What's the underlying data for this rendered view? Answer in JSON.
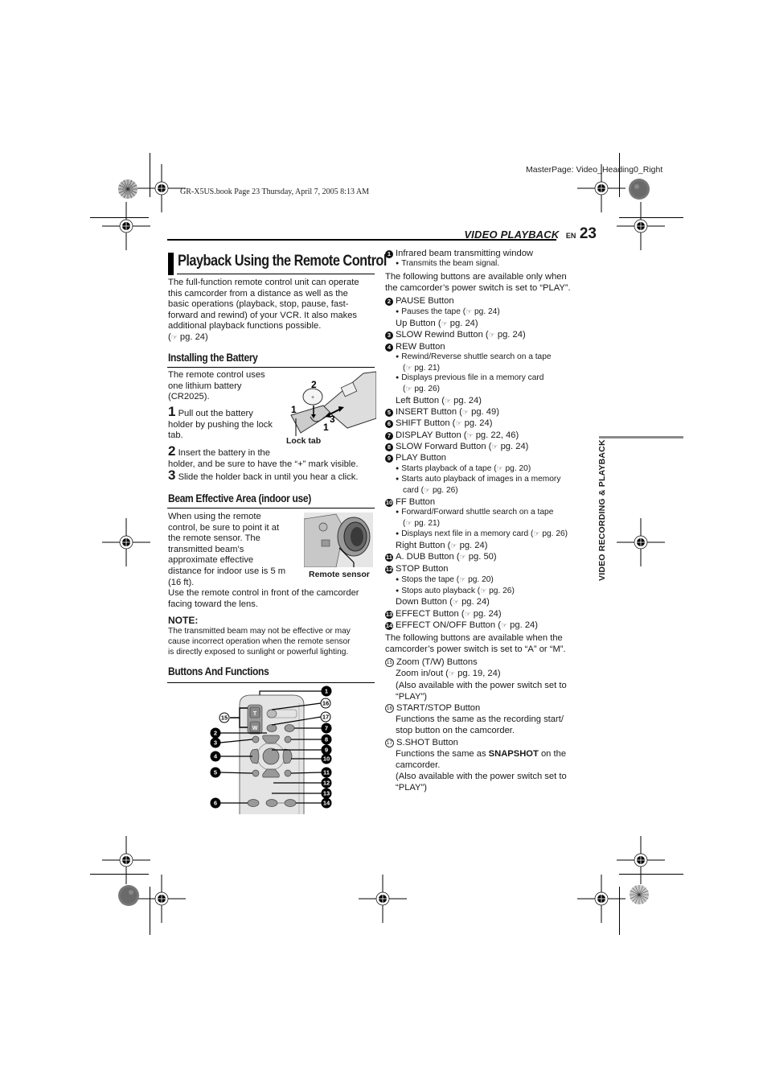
{
  "print_marks": {
    "book_info": "GR-X5US.book  Page 23  Thursday, April 7, 2005  8:13 AM",
    "master_page": "MasterPage: Video_Heading0_Right"
  },
  "header": {
    "section": "VIDEO PLAYBACK",
    "lang": "EN",
    "page_number": "23"
  },
  "sidebar": {
    "label": "VIDEO RECORDING & PLAYBACK",
    "bar_color": "#8a8a8a"
  },
  "main": {
    "title": "Playback Using the Remote Control",
    "intro": [
      "The full-function remote control unit can operate",
      "this camcorder from a distance as well as the",
      "basic operations (playback, stop, pause, fast-",
      "forward and rewind) of your VCR. It also makes",
      "additional playback functions possible."
    ],
    "intro_ref": "pg. 24",
    "battery": {
      "heading": "Installing the Battery",
      "text": [
        "The remote control uses",
        "one lithium battery",
        "(CR2025)."
      ],
      "steps": [
        {
          "num": "1",
          "lines": [
            "Pull out the battery",
            "holder by pushing the lock",
            "tab."
          ]
        },
        {
          "num": "2",
          "lines": [
            "Insert the battery in the",
            "holder, and be sure to have the “+” mark visible."
          ]
        },
        {
          "num": "3",
          "lines": [
            "Slide the holder back in until you hear a click."
          ]
        }
      ],
      "figure": {
        "callouts": [
          "2",
          "1",
          "3",
          "1"
        ],
        "caption": "Lock tab",
        "coin_mark": "+"
      }
    },
    "beam": {
      "heading": "Beam Effective Area (indoor use)",
      "text": [
        "When using the remote",
        "control, be sure to point it at",
        "the remote sensor. The",
        "transmitted beam’s",
        "approximate effective",
        "distance for indoor use is 5 m",
        "(16 ft)."
      ],
      "text2": [
        "Use the remote control in front of the camcorder",
        "facing toward the lens."
      ],
      "figure_caption": "Remote sensor"
    },
    "note": {
      "heading": "NOTE:",
      "lines": [
        "The transmitted beam may not be effective or may",
        "cause incorrect operation when the remote sensor",
        "is directly exposed to sunlight or powerful lighting."
      ]
    },
    "buttons": {
      "heading": "Buttons And Functions",
      "diagram": {
        "zoom_t": "T",
        "zoom_w": "W",
        "callouts_left": [
          "15",
          "2",
          "3",
          "4",
          "5",
          "6"
        ],
        "callouts_right": [
          "1",
          "16",
          "17",
          "7",
          "8",
          "9",
          "10",
          "11",
          "12",
          "13",
          "14"
        ]
      }
    }
  },
  "functions": {
    "intro_play": [
      "The following buttons are available only when",
      "the camcorder’s power switch is set to “PLAY”."
    ],
    "intro_am": [
      "The following buttons are available when the",
      "camcorder’s power switch is set to “A” or “M”."
    ],
    "items": [
      {
        "num": "1",
        "style": "filled",
        "label": "Infrared beam transmitting window",
        "subs": [
          {
            "text": "Transmits the beam signal."
          }
        ],
        "extra": []
      },
      {
        "num": "2",
        "style": "filled",
        "label": "PAUSE Button",
        "subs": [
          {
            "text": "Pauses the tape (",
            "ref": "pg. 24)"
          }
        ],
        "extra": [
          {
            "text": "Up Button (",
            "ref": "pg. 24)"
          }
        ]
      },
      {
        "num": "3",
        "style": "filled",
        "label": "SLOW Rewind Button (",
        "ref": "pg. 24)",
        "subs": [],
        "extra": []
      },
      {
        "num": "4",
        "style": "filled",
        "label": "REW Button",
        "subs": [
          {
            "text": "Rewind/Reverse shuttle search on a tape",
            "ref2": "pg. 21)"
          },
          {
            "text": "Displays previous file in a memory card",
            "ref2": "pg. 26)"
          }
        ],
        "extra": [
          {
            "text": "Left Button (",
            "ref": "pg. 24)"
          }
        ]
      },
      {
        "num": "5",
        "style": "filled",
        "label": "INSERT Button (",
        "ref": "pg. 49)",
        "subs": [],
        "extra": []
      },
      {
        "num": "6",
        "style": "filled",
        "label": "SHIFT Button (",
        "ref": "pg. 24)",
        "subs": [],
        "extra": []
      },
      {
        "num": "7",
        "style": "filled",
        "label": "DISPLAY Button (",
        "ref": "pg. 22, 46)",
        "subs": [],
        "extra": []
      },
      {
        "num": "8",
        "style": "filled",
        "label": "SLOW Forward Button (",
        "ref": "pg. 24)",
        "subs": [],
        "extra": []
      },
      {
        "num": "9",
        "style": "filled",
        "label": "PLAY Button",
        "subs": [
          {
            "text": "Starts playback of a tape (",
            "ref": "pg. 20)"
          },
          {
            "text": "Starts auto playback of images in a memory",
            "cont": "card (",
            "ref2": "pg. 26)"
          }
        ],
        "extra": []
      },
      {
        "num": "10",
        "style": "filled",
        "label": "FF Button",
        "subs": [
          {
            "text": "Forward/Forward shuttle search on a tape",
            "ref2": "pg. 21)"
          },
          {
            "text": "Displays next file in a memory card (",
            "ref": "pg. 26)"
          }
        ],
        "extra": [
          {
            "text": "Right Button (",
            "ref": "pg. 24)"
          }
        ]
      },
      {
        "num": "11",
        "style": "filled",
        "label": "A. DUB Button (",
        "ref": "pg. 50)",
        "subs": [],
        "extra": []
      },
      {
        "num": "12",
        "style": "filled",
        "label": "STOP Button",
        "subs": [
          {
            "text": "Stops the tape (",
            "ref": "pg. 20)"
          },
          {
            "text": "Stops auto playback (",
            "ref": "pg. 26)"
          }
        ],
        "extra": [
          {
            "text": "Down Button (",
            "ref": "pg. 24)"
          }
        ]
      },
      {
        "num": "13",
        "style": "filled",
        "label": "EFFECT Button (",
        "ref": "pg. 24)",
        "subs": [],
        "extra": []
      },
      {
        "num": "14",
        "style": "filled",
        "label": "EFFECT ON/OFF Button (",
        "ref": "pg. 24)",
        "subs": [],
        "extra": []
      },
      {
        "num": "15",
        "style": "outline",
        "label": "Zoom (T/W) Buttons",
        "subs": [],
        "extra": [
          {
            "text": "Zoom in/out (",
            "ref": "pg. 19, 24)"
          },
          {
            "text": "(Also available with the power switch set to"
          },
          {
            "text": "“PLAY”)"
          }
        ]
      },
      {
        "num": "16",
        "style": "outline",
        "label": "START/STOP Button",
        "subs": [],
        "extra": [
          {
            "text": "Functions the same as the recording start/"
          },
          {
            "text": "stop button on the camcorder."
          }
        ]
      },
      {
        "num": "17",
        "style": "outline",
        "label": "S.SHOT Button",
        "subs": [],
        "extra": [
          {
            "text": "Functions the same as ",
            "bold": "SNAPSHOT",
            "after": " on the"
          },
          {
            "text": "camcorder."
          },
          {
            "text": "(Also available with the power switch set to"
          },
          {
            "text": "“PLAY”)"
          }
        ]
      }
    ]
  },
  "icons": {
    "ref_icon": "☞",
    "bullet": "●"
  }
}
